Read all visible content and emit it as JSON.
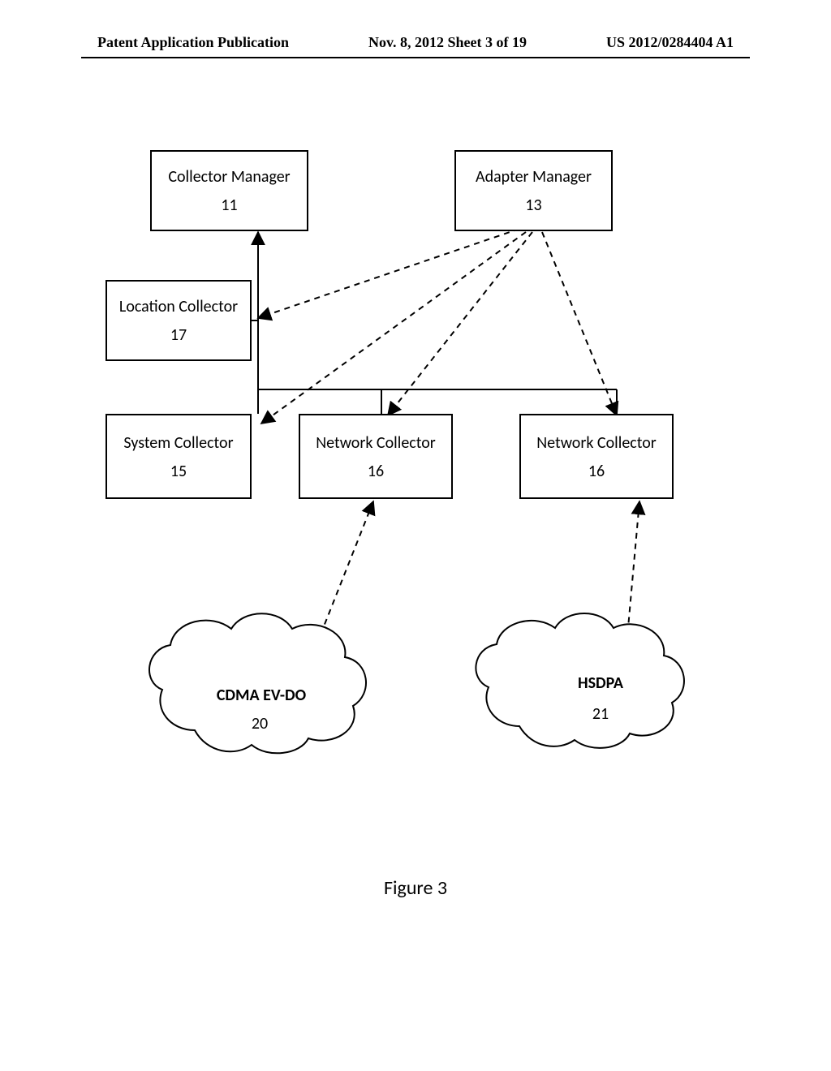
{
  "header": {
    "left": "Patent Application Publication",
    "mid": "Nov. 8, 2012  Sheet 3 of 19",
    "right": "US 2012/0284404 A1"
  },
  "boxes": {
    "collector_manager": {
      "title": "Collector Manager",
      "num": "11"
    },
    "adapter_manager": {
      "title": "Adapter Manager",
      "num": "13"
    },
    "location_collector": {
      "title": "Location Collector",
      "num": "17"
    },
    "system_collector": {
      "title": "System Collector",
      "num": "15"
    },
    "network_collector_a": {
      "title": "Network Collector",
      "num": "16"
    },
    "network_collector_b": {
      "title": "Network Collector",
      "num": "16"
    }
  },
  "clouds": {
    "cdma": {
      "label": "CDMA EV-DO",
      "num": "20"
    },
    "hsdpa": {
      "label": "HSDPA",
      "num": "21"
    }
  },
  "figure_caption": "Figure 3"
}
